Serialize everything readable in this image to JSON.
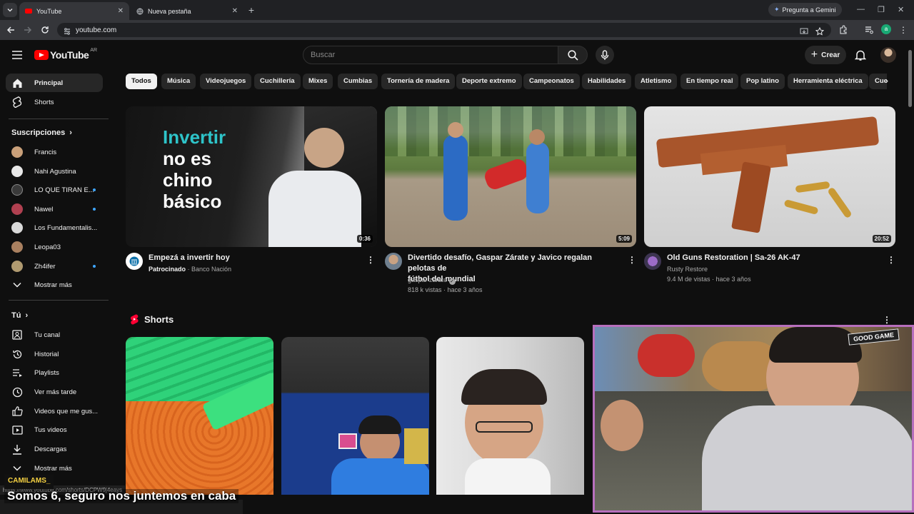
{
  "browser": {
    "tabs": [
      {
        "label": "YouTube",
        "active": true
      },
      {
        "label": "Nueva pestaña",
        "active": false
      }
    ],
    "gemini_label": "Pregunta a Gemini",
    "url": "youtube.com",
    "profile_initial": "a"
  },
  "masthead": {
    "logo_text": "YouTube",
    "region": "AR",
    "search_placeholder": "Buscar",
    "create_label": "Crear"
  },
  "sidebar": {
    "main": [
      {
        "label": "Principal",
        "icon": "home-icon",
        "active": true
      },
      {
        "label": "Shorts",
        "icon": "shorts-icon",
        "active": false
      }
    ],
    "subscriptions_title": "Suscripciones",
    "subscriptions": [
      {
        "label": "Francis",
        "dot": false,
        "color": "#c9a07a"
      },
      {
        "label": "Nahi Agustina",
        "dot": false,
        "color": "#e8e8e8"
      },
      {
        "label": "LO QUE TIRAN E...",
        "dot": true,
        "color": "#3a3a3a"
      },
      {
        "label": "Nawel",
        "dot": true,
        "color": "#b04050"
      },
      {
        "label": "Los Fundamentalis...",
        "dot": false,
        "color": "#d9d9d9"
      },
      {
        "label": "Leopa03",
        "dot": false,
        "color": "#a98060"
      },
      {
        "label": "Zh4ifer",
        "dot": true,
        "color": "#b09a70"
      }
    ],
    "show_more": "Mostrar más",
    "you_title": "Tú",
    "you_items": [
      {
        "label": "Tu canal",
        "icon": "channel-icon"
      },
      {
        "label": "Historial",
        "icon": "history-icon"
      },
      {
        "label": "Playlists",
        "icon": "playlist-icon"
      },
      {
        "label": "Ver más tarde",
        "icon": "clock-icon"
      },
      {
        "label": "Videos que me gus...",
        "icon": "thumbs-up-icon"
      },
      {
        "label": "Tus videos",
        "icon": "video-icon"
      },
      {
        "label": "Descargas",
        "icon": "download-icon"
      },
      {
        "label": "Mostrar más",
        "icon": "chevron-down-icon"
      }
    ]
  },
  "chips": [
    "Todos",
    "Música",
    "Videojuegos",
    "Cuchillería",
    "Mixes",
    "Cumbias",
    "Tornería de madera",
    "Deporte extremo",
    "Campeonatos",
    "Habilidades",
    "Atletismo",
    "En tiempo real",
    "Pop latino",
    "Herramienta eléctrica",
    "Cue"
  ],
  "videos": [
    {
      "title": "Empezá a invertir hoy",
      "title2": "",
      "thumb_text": [
        "Invertir",
        "no es",
        "chino",
        "básico"
      ],
      "channel": "Patrocinado",
      "channel_suffix": "· Banco Nación",
      "stats": "",
      "duration": "0:36"
    },
    {
      "title": "Divertido desafío, Gaspar Zárate y Javico regalan pelotas de",
      "title2": "fútbol del mundial",
      "channel": "gaspar zarate",
      "channel_suffix": "",
      "stats": "818 k vistas · hace 3 años",
      "duration": "5:09"
    },
    {
      "title": "Old Guns Restoration | Sa-26 AK-47",
      "title2": "",
      "channel": "Rusty Restore",
      "channel_suffix": "",
      "stats": "9.4 M de vistas · hace 3 años",
      "duration": "20:52"
    }
  ],
  "shorts_title": "Shorts",
  "overlay": {
    "streamer_name": "CAMILAMS_",
    "caption": "Somos 6, seguro nos juntemos en caba",
    "url_hint": "https://www.youtube.com/shorts/DCPW9j4eays",
    "webcam_sign": "GOOD GAME"
  }
}
